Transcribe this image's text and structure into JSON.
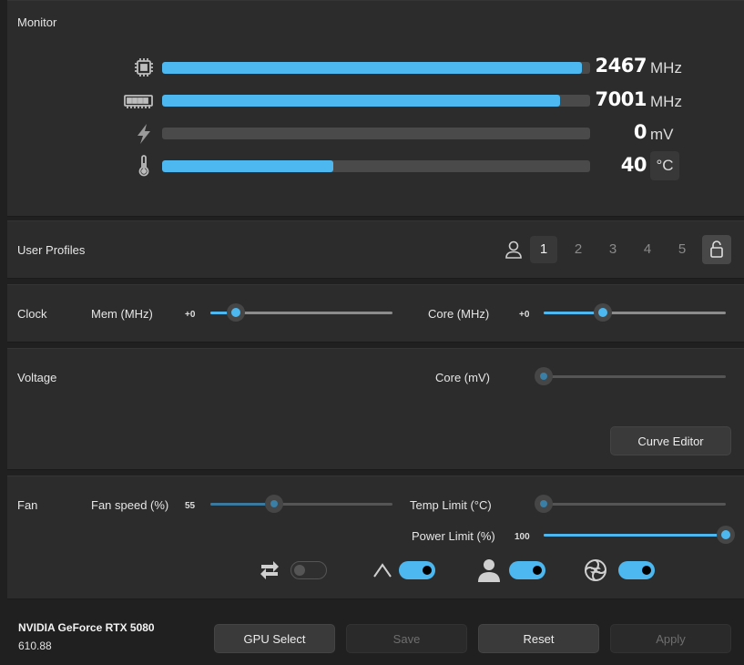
{
  "monitor": {
    "title": "Monitor",
    "rows": [
      {
        "icon": "cpu-chip-icon",
        "value": "2467",
        "unit": "MHz",
        "fill": 0.98
      },
      {
        "icon": "memory-icon",
        "value": "7001",
        "unit": "MHz",
        "fill": 0.93
      },
      {
        "icon": "lightning-bolt-icon",
        "value": "0",
        "unit": "mV",
        "fill": 0.0
      },
      {
        "icon": "thermometer-icon",
        "value": "40",
        "unit": "°C",
        "fill": 0.4
      }
    ]
  },
  "profiles": {
    "title": "User Profiles",
    "items": [
      "1",
      "2",
      "3",
      "4",
      "5"
    ],
    "selected": "1"
  },
  "clock": {
    "title": "Clock",
    "mem_label": "Mem (MHz)",
    "mem_value": "+0",
    "core_label": "Core (MHz)",
    "core_value": "+0"
  },
  "voltage": {
    "title": "Voltage",
    "core_label": "Core (mV)",
    "curve_editor": "Curve Editor"
  },
  "fan": {
    "title": "Fan",
    "speed_label": "Fan speed (%)",
    "speed_value": "55",
    "temp_limit_label": "Temp Limit (°C)",
    "power_limit_label": "Power Limit (%)",
    "power_limit_value": "100",
    "toggles": [
      {
        "icon": "sync-arrows-icon",
        "on": false
      },
      {
        "icon": "auto-mode-icon",
        "on": true
      },
      {
        "icon": "user-icon",
        "on": true
      },
      {
        "icon": "fan-sync-icon",
        "on": true
      }
    ]
  },
  "footer": {
    "gpu_name": "NVIDIA GeForce RTX 5080",
    "driver": "610.88",
    "gpu_select": "GPU Select",
    "save": "Save",
    "reset": "Reset",
    "apply": "Apply"
  },
  "colors": {
    "accent": "#4db8f0",
    "panel": "#2c2c2c",
    "background": "#202020"
  }
}
